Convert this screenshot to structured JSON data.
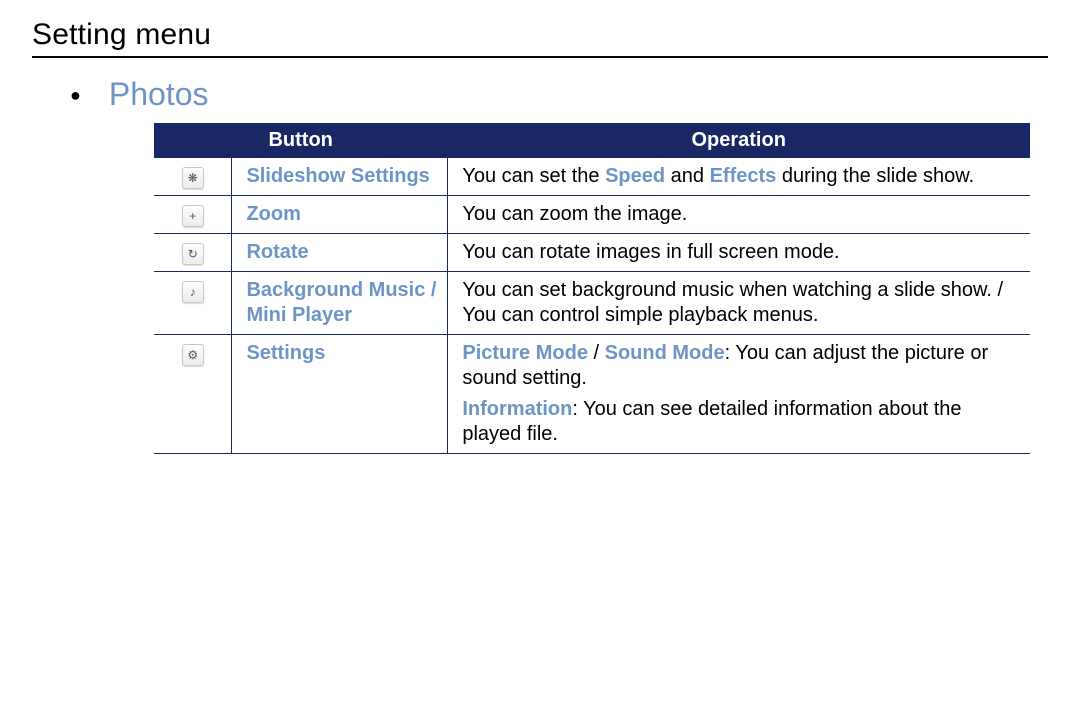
{
  "page_title": "Setting menu",
  "section_title": "Photos",
  "headers": {
    "button": "Button",
    "operation": "Operation"
  },
  "rows": [
    {
      "icon": "slideshow-icon",
      "glyph": "❋",
      "name_parts": [
        {
          "t": "Slideshow Settings",
          "hl": true
        }
      ],
      "op_parts": [
        [
          {
            "t": "You can set the ",
            "hl": false
          },
          {
            "t": "Speed",
            "hl": true
          },
          {
            "t": " and ",
            "hl": false
          },
          {
            "t": "Effects",
            "hl": true
          },
          {
            "t": " during the slide show.",
            "hl": false
          }
        ]
      ]
    },
    {
      "icon": "zoom-icon",
      "glyph": "+",
      "name_parts": [
        {
          "t": "Zoom",
          "hl": true
        }
      ],
      "op_parts": [
        [
          {
            "t": "You can zoom the image.",
            "hl": false
          }
        ]
      ]
    },
    {
      "icon": "rotate-icon",
      "glyph": "↻",
      "name_parts": [
        {
          "t": "Rotate",
          "hl": true
        }
      ],
      "op_parts": [
        [
          {
            "t": "You can rotate images in full screen mode.",
            "hl": false
          }
        ]
      ]
    },
    {
      "icon": "music-icon",
      "glyph": "♪",
      "name_parts": [
        {
          "t": "Background Music",
          "hl": true
        },
        {
          "t": " / ",
          "hl": false
        },
        {
          "t": "Mini Player",
          "hl": true
        }
      ],
      "op_parts": [
        [
          {
            "t": "You can set background music when watching a slide show. / You can control simple playback menus.",
            "hl": false
          }
        ]
      ]
    },
    {
      "icon": "settings-icon",
      "glyph": "⚙",
      "name_parts": [
        {
          "t": "Settings",
          "hl": true
        }
      ],
      "op_parts": [
        [
          {
            "t": "Picture Mode",
            "hl": true
          },
          {
            "t": " / ",
            "hl": false
          },
          {
            "t": "Sound Mode",
            "hl": true
          },
          {
            "t": ": You can adjust the picture or sound setting.",
            "hl": false
          }
        ],
        [
          {
            "t": "Information",
            "hl": true
          },
          {
            "t": ": You can see detailed information about the played file.",
            "hl": false
          }
        ]
      ]
    }
  ]
}
